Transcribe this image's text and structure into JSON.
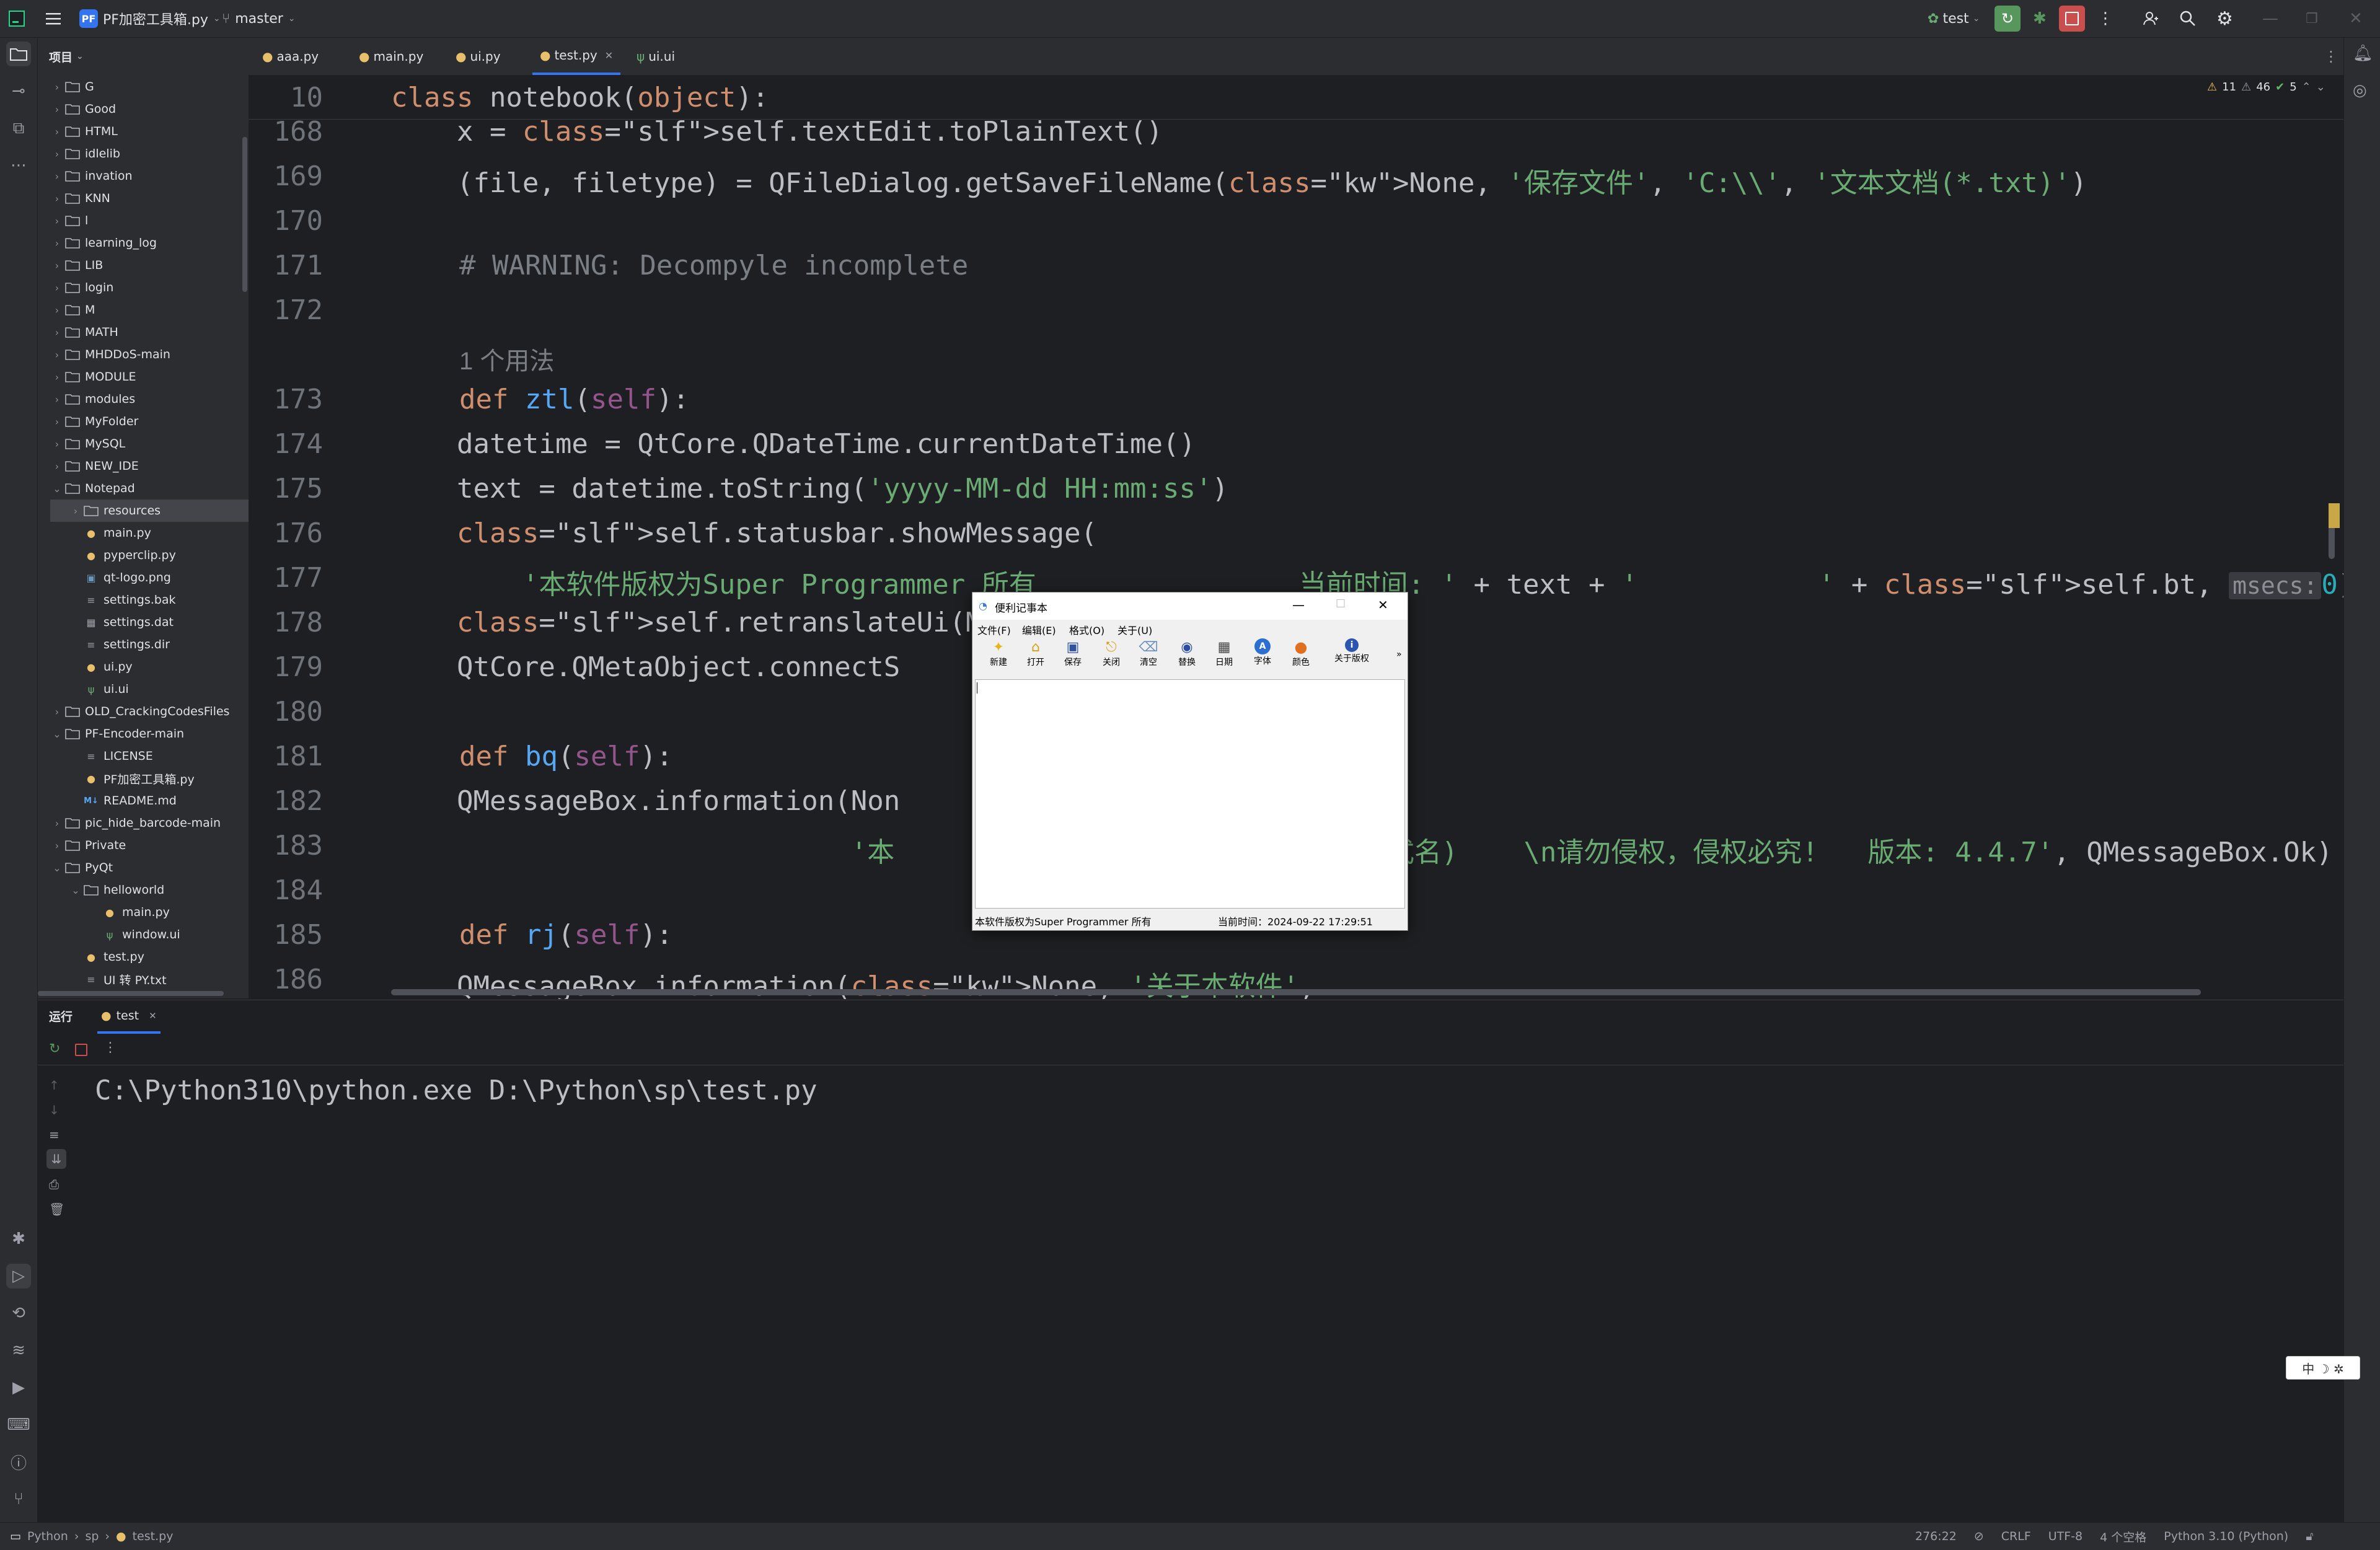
{
  "titlebar": {
    "project_badge": "PF",
    "project_name": "PF加密工具箱.py",
    "branch": "master",
    "run_config": "test"
  },
  "project_panel": {
    "header": "项目",
    "items": [
      {
        "label": "G",
        "type": "folder",
        "depth": 1,
        "expanded": false
      },
      {
        "label": "Good",
        "type": "folder",
        "depth": 1,
        "expanded": false
      },
      {
        "label": "HTML",
        "type": "folder",
        "depth": 1,
        "expanded": false
      },
      {
        "label": "idlelib",
        "type": "folder",
        "depth": 1,
        "expanded": false
      },
      {
        "label": "invation",
        "type": "folder",
        "depth": 1,
        "expanded": false
      },
      {
        "label": "KNN",
        "type": "folder",
        "depth": 1,
        "expanded": false
      },
      {
        "label": "l",
        "type": "folder",
        "depth": 1,
        "expanded": false
      },
      {
        "label": "learning_log",
        "type": "folder",
        "depth": 1,
        "expanded": false
      },
      {
        "label": "LIB",
        "type": "folder",
        "depth": 1,
        "expanded": false
      },
      {
        "label": "login",
        "type": "folder",
        "depth": 1,
        "expanded": false
      },
      {
        "label": "M",
        "type": "folder",
        "depth": 1,
        "expanded": false
      },
      {
        "label": "MATH",
        "type": "folder",
        "depth": 1,
        "expanded": false
      },
      {
        "label": "MHDDoS-main",
        "type": "folder",
        "depth": 1,
        "expanded": false
      },
      {
        "label": "MODULE",
        "type": "folder",
        "depth": 1,
        "expanded": false
      },
      {
        "label": "modules",
        "type": "folder",
        "depth": 1,
        "expanded": false
      },
      {
        "label": "MyFolder",
        "type": "folder",
        "depth": 1,
        "expanded": false
      },
      {
        "label": "MySQL",
        "type": "folder",
        "depth": 1,
        "expanded": false
      },
      {
        "label": "NEW_IDE",
        "type": "folder",
        "depth": 1,
        "expanded": false
      },
      {
        "label": "Notepad",
        "type": "folder",
        "depth": 1,
        "expanded": true
      },
      {
        "label": "resources",
        "type": "folder",
        "depth": 2,
        "expanded": false,
        "selected": true
      },
      {
        "label": "main.py",
        "type": "py",
        "depth": 2
      },
      {
        "label": "pyperclip.py",
        "type": "py",
        "depth": 2
      },
      {
        "label": "qt-logo.png",
        "type": "img",
        "depth": 2
      },
      {
        "label": "settings.bak",
        "type": "txt",
        "depth": 2
      },
      {
        "label": "settings.dat",
        "type": "dat",
        "depth": 2
      },
      {
        "label": "settings.dir",
        "type": "txt",
        "depth": 2
      },
      {
        "label": "ui.py",
        "type": "py",
        "depth": 2
      },
      {
        "label": "ui.ui",
        "type": "ui",
        "depth": 2
      },
      {
        "label": "OLD_CrackingCodesFiles",
        "type": "folder",
        "depth": 1,
        "expanded": false
      },
      {
        "label": "PF-Encoder-main",
        "type": "folder",
        "depth": 1,
        "expanded": true
      },
      {
        "label": "LICENSE",
        "type": "txt",
        "depth": 2
      },
      {
        "label": "PF加密工具箱.py",
        "type": "py",
        "depth": 2
      },
      {
        "label": "README.md",
        "type": "md",
        "depth": 2
      },
      {
        "label": "pic_hide_barcode-main",
        "type": "folder",
        "depth": 1,
        "expanded": false
      },
      {
        "label": "Private",
        "type": "folder",
        "depth": 1,
        "expanded": false
      },
      {
        "label": "PyQt",
        "type": "folder",
        "depth": 1,
        "expanded": true
      },
      {
        "label": "helloworld",
        "type": "folder",
        "depth": 2,
        "expanded": true
      },
      {
        "label": "main.py",
        "type": "py",
        "depth": 3
      },
      {
        "label": "window.ui",
        "type": "ui",
        "depth": 3
      },
      {
        "label": "test.py",
        "type": "py",
        "depth": 2
      },
      {
        "label": "UI 转 PY.txt",
        "type": "txt",
        "depth": 2
      }
    ]
  },
  "editor_tabs": [
    {
      "label": "aaa.py",
      "active": false
    },
    {
      "label": "main.py",
      "active": false
    },
    {
      "label": "ui.py",
      "active": false
    },
    {
      "label": "test.py",
      "active": true
    },
    {
      "label": "ui.ui",
      "active": false
    }
  ],
  "inspections": {
    "warnings": "11",
    "weak_warnings": "46",
    "ok": "5"
  },
  "code": {
    "sticky_line": "10",
    "sticky_text": "class notebook(object):",
    "lines": [
      {
        "n": "168",
        "text": "    x = self.textEdit.toPlainText()"
      },
      {
        "n": "169",
        "text": "    (file, filetype) = QFileDialog.getSaveFileName(None, '保存文件', 'C:\\\\', '文本文档(*.txt)')"
      },
      {
        "n": "170",
        "text": ""
      },
      {
        "n": "171",
        "text": "# WARNING: Decompyle incomplete"
      },
      {
        "n": "172",
        "text": ""
      },
      {
        "n": "",
        "text": "1 个用法"
      },
      {
        "n": "173",
        "text": "def ztl(self):"
      },
      {
        "n": "174",
        "text": "    datetime = QtCore.QDateTime.currentDateTime()"
      },
      {
        "n": "175",
        "text": "    text = datetime.toString('yyyy-MM-dd HH:mm:ss')"
      },
      {
        "n": "176",
        "text": "    self.statusbar.showMessage("
      },
      {
        "n": "177",
        "text": "        '本软件版权为Super Programmer 所有                当前时间: ' + text + '           ' + self.bt, msecs: 0)"
      },
      {
        "n": "178",
        "text": "    self.retranslateUi(MainWind"
      },
      {
        "n": "179",
        "text": "    QtCore.QMetaObject.connectS"
      },
      {
        "n": "180",
        "text": ""
      },
      {
        "n": "181",
        "text": "def bq(self):"
      },
      {
        "n": "182",
        "text": "    QMessageBox.information(Non"
      },
      {
        "n": "183",
        "text": "                            '本                              式名)    \\n请勿侵权，侵权必究!   版本: 4.4.7', QMessageBox.Ok)"
      },
      {
        "n": "184",
        "text": ""
      },
      {
        "n": "185",
        "text": "def rj(self):"
      },
      {
        "n": "186",
        "text": "    QMessageBox.information(None, '关于本软件',"
      }
    ]
  },
  "run_panel": {
    "title": "运行",
    "tab": "test",
    "output": "C:\\Python310\\python.exe D:\\Python\\sp\\test.py"
  },
  "statusbar": {
    "breadcrumb": [
      "Python",
      "sp",
      "test.py"
    ],
    "position": "276:22",
    "line_sep": "CRLF",
    "encoding": "UTF-8",
    "indent": "4 个空格",
    "interpreter": "Python 3.10 (Python)"
  },
  "notepad": {
    "title": "便利记事本",
    "menus": [
      "文件(F)",
      "编辑(E)",
      "格式(O)",
      "关于(U)"
    ],
    "tools": [
      "新建",
      "打开",
      "保存",
      "关闭",
      "清空",
      "替换",
      "日期",
      "字体",
      "颜色",
      "关于版权"
    ],
    "status_left": "本软件版权为Super Programmer 所有",
    "status_right": "当前时间：2024-09-22 17:29:51"
  },
  "ime": {
    "label": "中 ☽ ✲"
  },
  "colors": {
    "accent": "#3574f0",
    "bg": "#1e1f22",
    "panel": "#2b2d30"
  }
}
